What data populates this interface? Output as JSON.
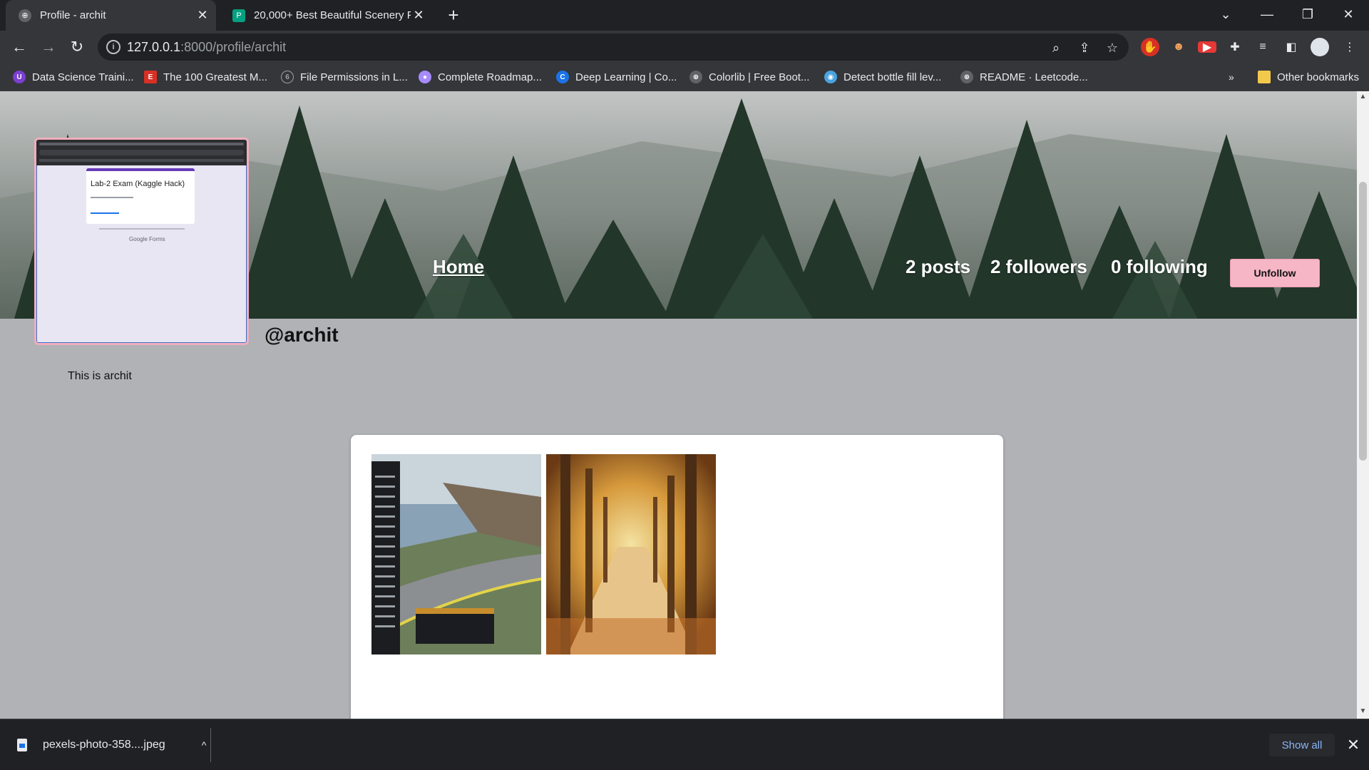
{
  "browser": {
    "tabs": [
      {
        "title": "Profile - archit",
        "active": true,
        "icon": "globe-icon"
      },
      {
        "title": "20,000+ Best Beautiful Scenery P",
        "active": false,
        "icon": "pexels-icon"
      }
    ],
    "address": {
      "host": "127.0.0.1",
      "rest": ":8000/profile/archit"
    },
    "bookmarks": [
      {
        "label": "Data Science Traini...",
        "icon": "data-science-icon",
        "color": "#7b3fd1"
      },
      {
        "label": "The 100 Greatest M...",
        "icon": "e-icon",
        "color": "#d93025"
      },
      {
        "label": "File Permissions in L...",
        "icon": "file-icon",
        "color": "#5f6368"
      },
      {
        "label": "Complete Roadmap...",
        "icon": "roadmap-icon",
        "color": "#a78bfa"
      },
      {
        "label": "Deep Learning | Co...",
        "icon": "coursera-icon",
        "color": "#1a73e8"
      },
      {
        "label": "Colorlib | Free Boot...",
        "icon": "globe-icon",
        "color": "#5f6368"
      },
      {
        "label": "Detect bottle fill lev...",
        "icon": "eye-icon",
        "color": "#4aa3df"
      },
      {
        "label": "README · Leetcode...",
        "icon": "globe-icon",
        "color": "#5f6368"
      }
    ],
    "overflow": "»",
    "other_bookmarks": "Other bookmarks"
  },
  "profile": {
    "nav_home": "Home",
    "posts": "2 posts",
    "followers": "2 followers",
    "following": "0 following",
    "unfollow_label": "Unfollow",
    "handle": "@archit",
    "bio": "This is archit",
    "avatar_image": {
      "form_title": "Lab-2 Exam (Kaggle Hack)",
      "footer": "Google Forms"
    }
  },
  "downloads": {
    "file": "pexels-photo-358....jpeg",
    "show_all": "Show all"
  }
}
